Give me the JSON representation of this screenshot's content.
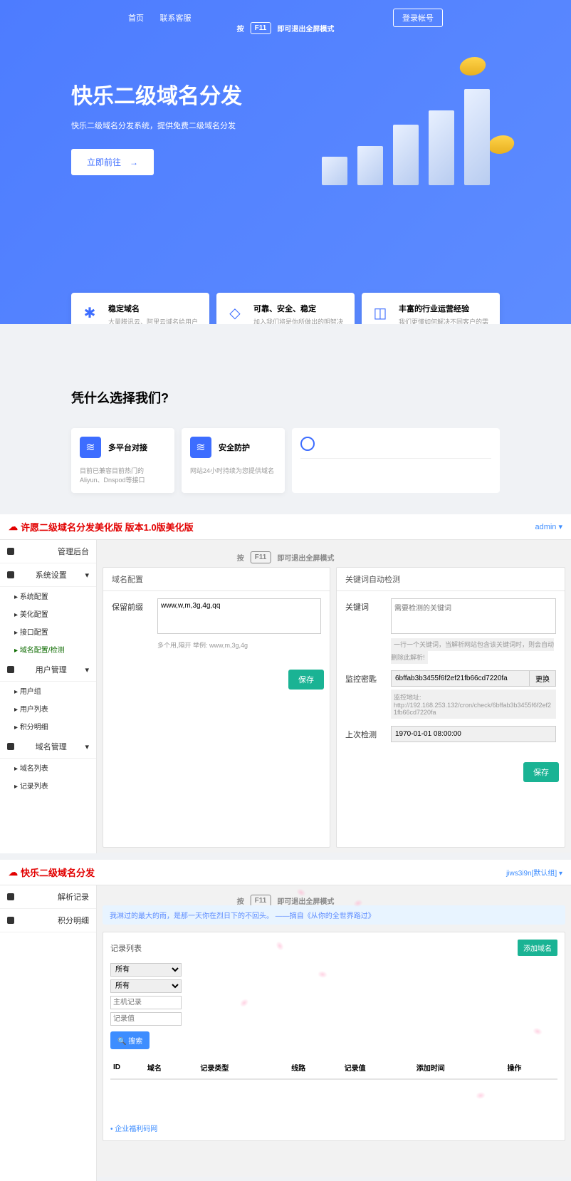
{
  "s1": {
    "nav": [
      "首页",
      "联系客服"
    ],
    "login": "登录帐号",
    "f11": {
      "pre": "按",
      "key": "F11",
      "post": "即可退出全屏模式"
    },
    "title": "快乐二级域名分发",
    "sub": "快乐二级域名分发系统，提供免费二级域名分发",
    "cta": "立即前往",
    "cards": [
      {
        "t": "稳定域名",
        "d": "大量腾讯云、阿里云域名给用户更好的体验"
      },
      {
        "t": "可靠、安全、稳定",
        "d": "加入我们将是你所做出的明智决策"
      },
      {
        "t": "丰富的行业运营经验",
        "d": "我们更懂如何解决不同客户的需求"
      }
    ],
    "why_t": "凭什么选择我们?",
    "why": [
      {
        "t": "多平台对接",
        "d": "目前已兼容目前热门的Aliyun、Dnspod等接口"
      },
      {
        "t": "安全防护",
        "d": "网站24小时持续为您提供域名"
      }
    ]
  },
  "s2": {
    "brand": "许愿二级域名分发美化版 版本1.0版美化版",
    "user": "admin ▾",
    "f11": {
      "pre": "按",
      "key": "F11",
      "post": "即可退出全屏模式"
    },
    "side": {
      "h1": "管理后台",
      "h2": "系统设置",
      "sub2": [
        "系统配置",
        "美化配置",
        "接口配置",
        "域名配置/检测"
      ],
      "h3": "用户管理",
      "sub3": [
        "用户组",
        "用户列表",
        "积分明细"
      ],
      "h4": "域名管理",
      "sub4": [
        "域名列表",
        "记录列表"
      ]
    },
    "p1": {
      "title": "域名配置",
      "label": "保留前缀",
      "val": "www,w,m,3g,4g,qq",
      "hint": "多个用,隔开 举例: www,m,3g,4g",
      "save": "保存"
    },
    "p2": {
      "title": "关键词自动检测",
      "r1": {
        "l": "关键词",
        "ph": "需要检测的关键词",
        "hint": "一行一个关键词，当解析网站包含该关键词时，则会自动删除此解析!"
      },
      "r2": {
        "l": "监控密匙",
        "v": "6bffab3b3455f6f2ef21fb66cd7220fa",
        "btn": "更换",
        "ht": "监控地址:",
        "hv": "http://192.168.253.132/cron/check/6bffab3b3455f6f2ef21fb66cd7220fa"
      },
      "r3": {
        "l": "上次检测",
        "v": "1970-01-01 08:00:00"
      },
      "save": "保存"
    }
  },
  "s3": {
    "brand": "快乐二级域名分发",
    "user": "jiws3i9n[默认组] ▾",
    "f11": {
      "pre": "按",
      "key": "F11",
      "post": "即可退出全屏模式"
    },
    "side": [
      "解析记录",
      "积分明细"
    ],
    "note": "我淋过的最大的雨，是那一天你在烈日下的不回头。 ——摘自《从你的全世界路过》",
    "panel_t": "记录列表",
    "add": "添加域名",
    "sel": "所有",
    "inp1": "主机记录",
    "inp2": "记录值",
    "srch": "搜索",
    "th": [
      "ID",
      "域名",
      "记录类型",
      "线路",
      "记录值",
      "添加时间",
      "操作"
    ],
    "link": "企业福利码网"
  }
}
